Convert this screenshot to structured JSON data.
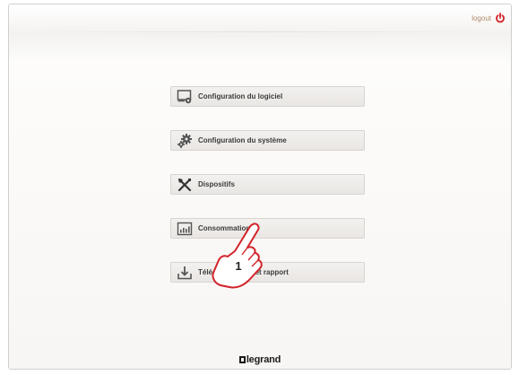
{
  "header": {
    "logout_label": "logout",
    "logout_icon": "power-icon",
    "accent_color": "#d2232a"
  },
  "menu": {
    "items": [
      {
        "label": "Configuration du logiciel",
        "icon": "software-config-icon"
      },
      {
        "label": "Configuration du système",
        "icon": "system-config-gears-icon"
      },
      {
        "label": "Dispositifs",
        "icon": "devices-tools-icon"
      },
      {
        "label": "Consommation",
        "icon": "consumption-chart-icon"
      },
      {
        "label": "Téléchargement et rapport",
        "icon": "download-report-icon"
      }
    ]
  },
  "overlay": {
    "step_number": "1",
    "pointer_icon": "hand-pointer-icon"
  },
  "footer": {
    "brand": "legrand"
  }
}
